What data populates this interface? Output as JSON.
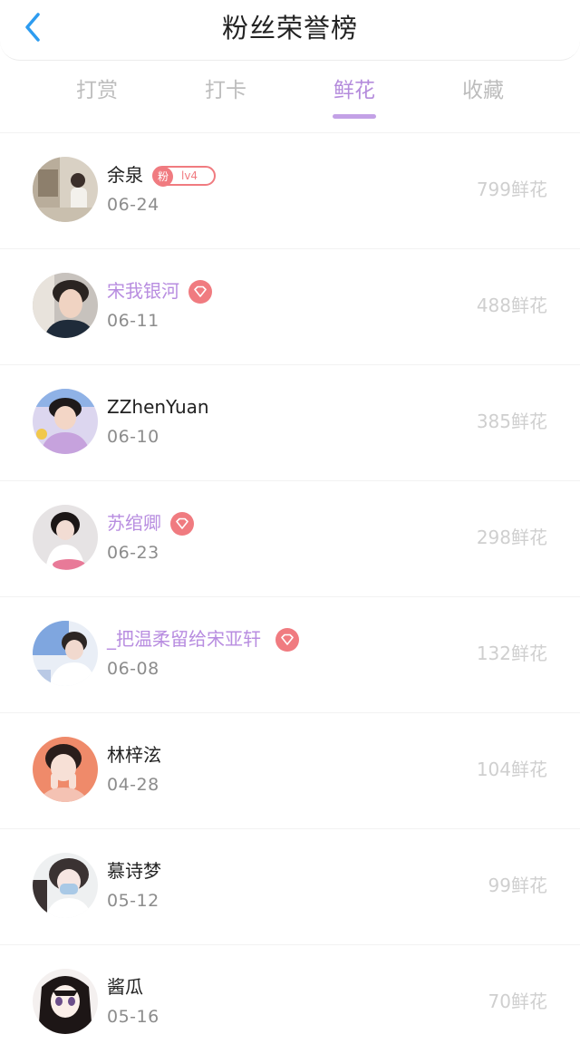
{
  "header": {
    "title": "粉丝荣誉榜"
  },
  "tabs": [
    {
      "label": "打赏"
    },
    {
      "label": "打卡"
    },
    {
      "label": "鲜花"
    },
    {
      "label": "收藏"
    }
  ],
  "active_tab": "鲜花",
  "colors": {
    "accent": "#b48bdc",
    "badge_red": "#f07b80",
    "back_arrow": "#2d9cf0"
  },
  "fans": [
    {
      "name": "余泉",
      "date": "06-24",
      "amount": "799鲜花",
      "badge": "fan",
      "fan_badge_icon": "粉",
      "fan_level": "lv4",
      "vip": false
    },
    {
      "name": "宋我银河",
      "date": "06-11",
      "amount": "488鲜花",
      "badge": "diamond-icon",
      "vip": true
    },
    {
      "name": "ZZhenYuan",
      "date": "06-10",
      "amount": "385鲜花",
      "badge": "",
      "vip": false
    },
    {
      "name": "苏绾卿",
      "date": "06-23",
      "amount": "298鲜花",
      "badge": "diamond-icon",
      "vip": true
    },
    {
      "name": "_把温柔留给宋亚轩",
      "date": "06-08",
      "amount": "132鲜花",
      "badge": "diamond-icon",
      "vip": true
    },
    {
      "name": "林梓泫",
      "date": "04-28",
      "amount": "104鲜花",
      "badge": "",
      "vip": false
    },
    {
      "name": "慕诗梦",
      "date": "05-12",
      "amount": "99鲜花",
      "badge": "",
      "vip": false
    },
    {
      "name": "酱瓜",
      "date": "05-16",
      "amount": "70鲜花",
      "badge": "",
      "vip": false
    }
  ]
}
